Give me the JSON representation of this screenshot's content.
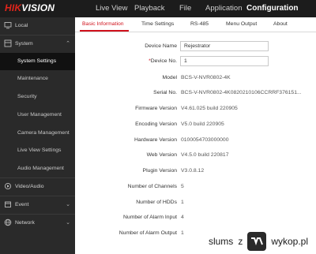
{
  "brand": {
    "logo_red": "HIK",
    "logo_white": "VISION"
  },
  "topnav": {
    "items": [
      {
        "label": "Live View"
      },
      {
        "label": "Playback"
      },
      {
        "label": "File"
      },
      {
        "label": "Application"
      },
      {
        "label": "Configuration"
      }
    ],
    "active": "Configuration"
  },
  "sidebar": {
    "local": "Local",
    "system": "System",
    "system_children": [
      "System Settings",
      "Maintenance",
      "Security",
      "User Management",
      "Camera Management",
      "Live View Settings",
      "Audio Management"
    ],
    "active_child": "System Settings",
    "video_audio": "Video/Audio",
    "event": "Event",
    "network": "Network"
  },
  "tabs": [
    "Basic Information",
    "Time Settings",
    "RS-485",
    "Menu Output",
    "About"
  ],
  "active_tab": "Basic Information",
  "form": {
    "device_name_label": "Device Name",
    "device_name_value": "Rejestrator",
    "device_no_required": "*",
    "device_no_label": "Device No.",
    "device_no_value": "1",
    "info_rows": [
      {
        "label": "Model",
        "value": "BCS-V-NVR0802-4K"
      },
      {
        "label": "Serial No.",
        "value": "BCS-V-NVR0802-4K0820210106CCRRF376151..."
      },
      {
        "label": "Firmware Version",
        "value": "V4.61.025 build 220905"
      },
      {
        "label": "Encoding Version",
        "value": "V5.0 build 220905"
      },
      {
        "label": "Hardware Version",
        "value": "0100054703000000"
      },
      {
        "label": "Web Version",
        "value": "V4.5.0 build 220817"
      },
      {
        "label": "Plugin Version",
        "value": "V3.0.8.12"
      },
      {
        "label": "Number of Channels",
        "value": "5"
      },
      {
        "label": "Number of HDDs",
        "value": "1"
      },
      {
        "label": "Number of Alarm Input",
        "value": "4"
      },
      {
        "label": "Number of Alarm Output",
        "value": "1"
      }
    ]
  },
  "watermark": {
    "user": "slums",
    "separator": "z",
    "site": "wykop.pl"
  },
  "colors": {
    "accent": "#d0111b",
    "sidebar_bg": "#2a2a2a",
    "topbar_bg": "#1c1c1c"
  },
  "icons": [
    "monitor-icon",
    "system-icon",
    "video-audio-icon",
    "event-icon",
    "network-icon"
  ]
}
